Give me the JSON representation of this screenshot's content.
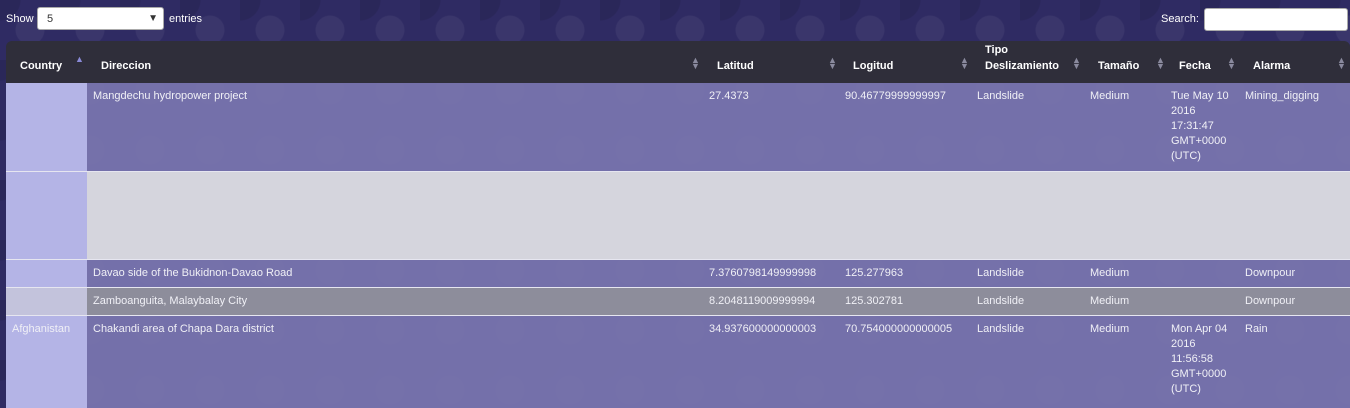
{
  "controls": {
    "show_label": "Show",
    "entries_value": "5",
    "entries_label": "entries",
    "search_label": "Search:",
    "search_value": ""
  },
  "columns": [
    {
      "key": "country",
      "label": "Country",
      "sorted": "asc"
    },
    {
      "key": "direccion",
      "label": "Direccion"
    },
    {
      "key": "latitud",
      "label": "Latitud"
    },
    {
      "key": "longitud",
      "label": "Logitud"
    },
    {
      "key": "tipo",
      "label_line1": "Tipo",
      "label_line2": "Deslizamiento"
    },
    {
      "key": "tamano",
      "label": "Tamaño"
    },
    {
      "key": "fecha",
      "label": "Fecha"
    },
    {
      "key": "alarma",
      "label": "Alarma"
    }
  ],
  "rows": [
    {
      "country": "",
      "direccion": "Mangdechu hydropower project",
      "latitud": "27.4373",
      "longitud": "90.46779999999997",
      "tipo": "Landslide",
      "tamano": "Medium",
      "fecha": [
        "Tue May 10",
        "2016",
        "17:31:47",
        "GMT+0000",
        "(UTC)"
      ],
      "alarma": "Mining_digging"
    },
    {
      "country": "",
      "direccion": "",
      "latitud": "",
      "longitud": "",
      "tipo": "",
      "tamano": "",
      "fecha": [],
      "alarma": ""
    },
    {
      "country": "",
      "direccion": "Davao side of the Bukidnon-Davao Road",
      "latitud": "7.3760798149999998",
      "longitud": "125.277963",
      "tipo": "Landslide",
      "tamano": "Medium",
      "fecha": [],
      "alarma": "Downpour"
    },
    {
      "country": "",
      "direccion": "Zamboanguita, Malaybalay City",
      "latitud": "8.2048119009999994",
      "longitud": "125.302781",
      "tipo": "Landslide",
      "tamano": "Medium",
      "fecha": [],
      "alarma": "Downpour"
    },
    {
      "country": "Afghanistan",
      "direccion": "Chakandi area of Chapa Dara district",
      "latitud": "34.937600000000003",
      "longitud": "70.754000000000005",
      "tipo": "Landslide",
      "tamano": "Medium",
      "fecha": [
        "Mon Apr 04",
        "2016",
        "11:56:58",
        "GMT+0000",
        "(UTC)"
      ],
      "alarma": "Rain"
    }
  ]
}
